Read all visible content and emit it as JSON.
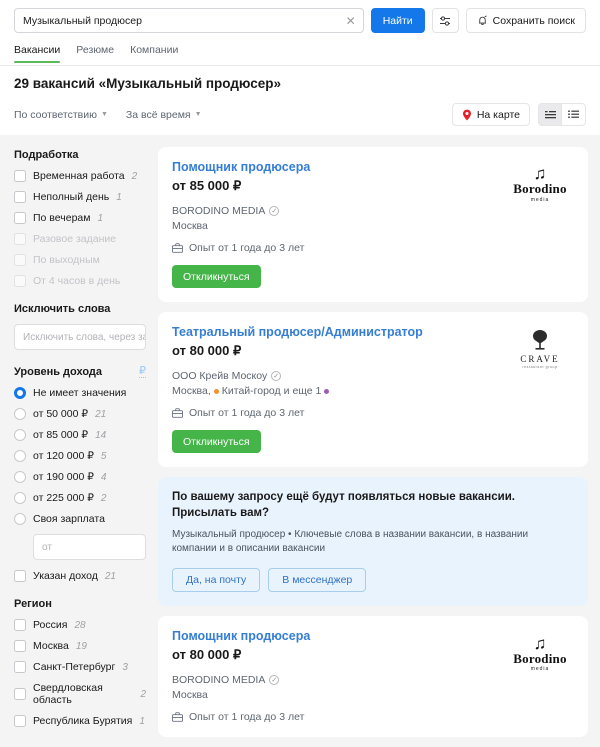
{
  "search": {
    "query": "Музыкальный продюсер",
    "clear_icon": "close-icon",
    "find_label": "Найти",
    "filters_icon": "sliders-icon",
    "save_label": "Сохранить поиск",
    "save_icon": "bell-icon"
  },
  "tabs": [
    {
      "label": "Вакансии",
      "active": true
    },
    {
      "label": "Резюме",
      "active": false
    },
    {
      "label": "Компании",
      "active": false
    }
  ],
  "results": {
    "title": "29 вакансий «Музыкальный продюсер»",
    "sort_label": "По соответствию",
    "period_label": "За всё время",
    "map_label": "На карте",
    "map_icon": "map-pin-icon",
    "view_compact_icon": "list-compact-icon",
    "view_detailed_icon": "list-detailed-icon"
  },
  "sidebar": {
    "groups": [
      {
        "title": "Подработка",
        "type": "checkbox",
        "options": [
          {
            "label": "Временная работа",
            "count": "2",
            "disabled": false
          },
          {
            "label": "Неполный день",
            "count": "1",
            "disabled": false
          },
          {
            "label": "По вечерам",
            "count": "1",
            "disabled": false
          },
          {
            "label": "Разовое задание",
            "count": "",
            "disabled": true
          },
          {
            "label": "По выходным",
            "count": "",
            "disabled": true
          },
          {
            "label": "От 4 часов в день",
            "count": "",
            "disabled": true
          }
        ]
      }
    ],
    "exclude": {
      "title": "Исключить слова",
      "placeholder": "Исключить слова, через запятую"
    },
    "income": {
      "title": "Уровень дохода",
      "currency": "₽",
      "options": [
        {
          "label": "Не имеет значения",
          "count": "",
          "checked": true
        },
        {
          "label": "от 50 000 ₽",
          "count": "21",
          "checked": false
        },
        {
          "label": "от 85 000 ₽",
          "count": "14",
          "checked": false
        },
        {
          "label": "от 120 000 ₽",
          "count": "5",
          "checked": false
        },
        {
          "label": "от 190 000 ₽",
          "count": "4",
          "checked": false
        },
        {
          "label": "от 225 000 ₽",
          "count": "2",
          "checked": false
        },
        {
          "label": "Своя зарплата",
          "count": "",
          "checked": false
        }
      ],
      "own_salary_placeholder": "от",
      "specified_label": "Указан доход",
      "specified_count": "21"
    },
    "region": {
      "title": "Регион",
      "options": [
        {
          "label": "Россия",
          "count": "28"
        },
        {
          "label": "Москва",
          "count": "19"
        },
        {
          "label": "Санкт-Петербург",
          "count": "3"
        },
        {
          "label": "Свердловская область",
          "count": "2"
        },
        {
          "label": "Республика Бурятия",
          "count": "1"
        }
      ]
    }
  },
  "vacancies": [
    {
      "title": "Помощник продюсера",
      "salary": "от 85 000 ₽",
      "company": "BORODINO MEDIA",
      "verified": true,
      "city": "Москва",
      "metro": "",
      "metro_more": "",
      "experience": "Опыт от 1 года до 3 лет",
      "apply_label": "Откликнуться",
      "logo": "borodino",
      "logo_name": "Borodino",
      "logo_sub": "media"
    },
    {
      "title": "Театральный продюсер/Администратор",
      "salary": "от 80 000 ₽",
      "company": "ООО Крейв Москоу",
      "verified": true,
      "city": "Москва,",
      "metro": "Китай-город",
      "metro_more": "и еще 1",
      "experience": "Опыт от 1 года до 3 лет",
      "apply_label": "Откликнуться",
      "logo": "crave",
      "logo_name": "CRAVE",
      "logo_sub": "restaurant group"
    },
    {
      "title": "Помощник продюсера",
      "salary": "от 80 000 ₽",
      "company": "BORODINO MEDIA",
      "verified": true,
      "city": "Москва",
      "metro": "",
      "metro_more": "",
      "experience": "Опыт от 1 года до 3 лет",
      "apply_label": "",
      "logo": "borodino",
      "logo_name": "Borodino",
      "logo_sub": "media"
    }
  ],
  "banner": {
    "title": "По вашему запросу ещё будут появляться новые вакансии. Присылать вам?",
    "subtitle": "Музыкальный продюсер • Ключевые слова в названии вакансии, в названии компании и в описании вакансии",
    "email_label": "Да, на почту",
    "messenger_label": "В мессенджер"
  },
  "colors": {
    "accent_blue": "#1478ea",
    "link_blue": "#357ed3",
    "apply_green": "#46b549",
    "tab_green": "#5cb85c",
    "banner_bg": "#e9f3fd",
    "metro_orange": "#f3922b",
    "metro_purple": "#9a5fb5",
    "map_pin_red": "#e4202a"
  }
}
